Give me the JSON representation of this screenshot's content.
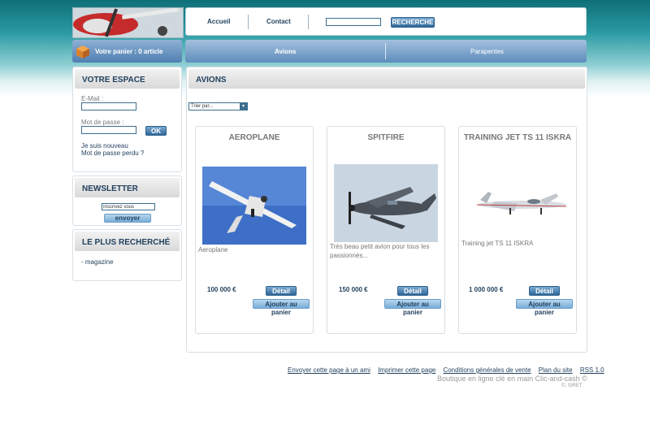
{
  "header": {
    "nav": {
      "home": "Accueil",
      "contact": "Contact"
    },
    "search": {
      "value": "",
      "button": "RECHERCHE"
    }
  },
  "cart": {
    "label": "Votre panier : 0 article"
  },
  "categories": {
    "items": [
      "Avions",
      "Parapentes"
    ],
    "active": "Avions"
  },
  "sidebar": {
    "account": {
      "title": "VOTRE ESPACE",
      "email_label": "E-Mail :",
      "password_label": "Mot de passe :",
      "ok": "OK",
      "new_user": "Je suis nouveau",
      "forgot": "Mot de passe perdu ?"
    },
    "newsletter": {
      "title": "NEWSLETTER",
      "input_value": "Inscrivez vous",
      "button": "envoyer"
    },
    "popular": {
      "title": "LE PLUS RECHERCHÉ",
      "items": [
        "- magazine"
      ]
    }
  },
  "main": {
    "title": "AVIONS",
    "sort_label": "Trier par...",
    "products": [
      {
        "title": "AEROPLANE",
        "desc": "Aeroplane",
        "price": "100 000 €",
        "detail": "Détail",
        "add": "Ajouter au panier"
      },
      {
        "title": "SPITFIRE",
        "desc": "Très beau petit avion pour tous les passionnés...",
        "price": "150 000 €",
        "detail": "Détail",
        "add": "Ajouter au panier"
      },
      {
        "title": "TRAINING JET TS 11 ISKRA",
        "desc": "Training jet TS 11 ISKRA",
        "price": "1 000 000 €",
        "detail": "Détail",
        "add": "Ajouter au panier"
      }
    ]
  },
  "footer": {
    "links": [
      "Envoyer cette page à un ami",
      "Imprimer cette page",
      "Conditions générales de vente",
      "Plan du site",
      "RSS 1.0"
    ],
    "tagline": "Boutique en ligne clé en main Clic-and-cash ©",
    "siret": "©, SIRET :"
  },
  "colors": {
    "accent": "#1f3f5c",
    "button": "#2f679a",
    "header_teal": "#0f6f78"
  }
}
